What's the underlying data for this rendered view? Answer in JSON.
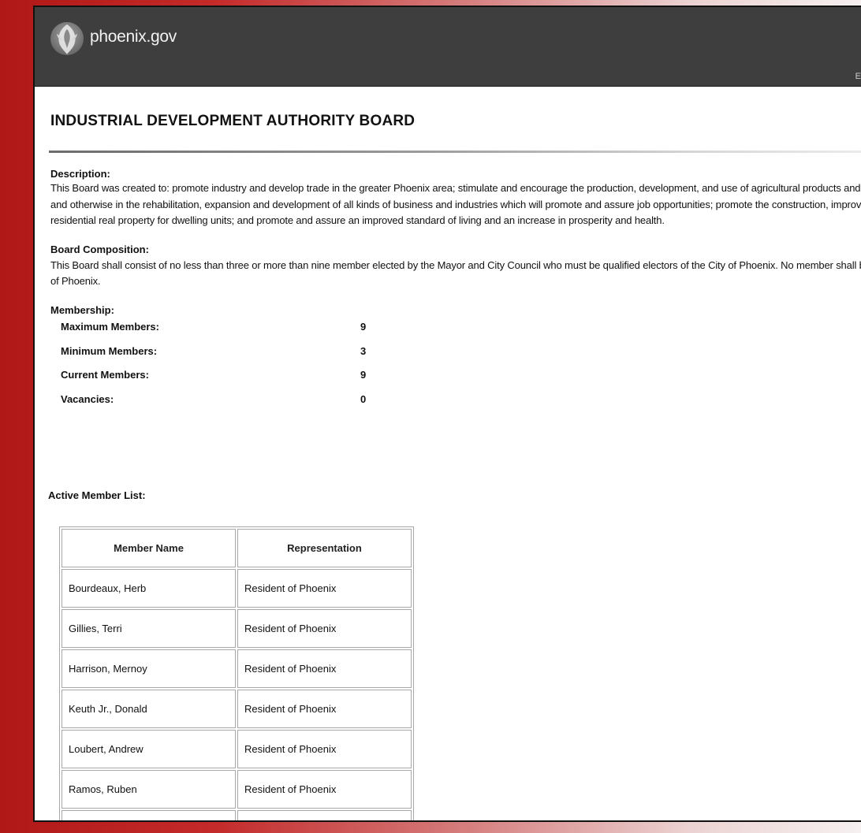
{
  "header": {
    "site_name": "phoenix.gov",
    "edge_text": "E",
    "logo_icon": "phoenix-bird-logo-icon"
  },
  "page": {
    "title": "INDUSTRIAL DEVELOPMENT AUTHORITY BOARD"
  },
  "description": {
    "label": "Description:",
    "lines": [
      "This Board was created to: promote industry and develop trade in the greater Phoenix area; stimulate and encourage the production, development, and use of agricultural products and na",
      "and otherwise in the rehabilitation, expansion and development of all kinds of business and industries which will promote and assure job opportunities; promote the construction, improve",
      "residential real property for dwelling units; and promote and assure an improved standard of living and an increase in prosperity and health."
    ]
  },
  "composition": {
    "label": "Board Composition:",
    "lines": [
      "This Board shall consist of no less than three or more than nine member elected by the Mayor and City Council who must be qualified electors of the City of Phoenix. No member shall be",
      "of Phoenix."
    ]
  },
  "membership": {
    "label": "Membership:",
    "rows": [
      {
        "label": "Maximum Members:",
        "value": "9"
      },
      {
        "label": "Minimum Members:",
        "value": "3"
      },
      {
        "label": "Current Members:",
        "value": "9"
      },
      {
        "label": "Vacancies:",
        "value": "0"
      }
    ]
  },
  "member_list": {
    "label": "Active Member List:",
    "columns": [
      "Member Name",
      "Representation"
    ],
    "rows": [
      [
        "Bourdeaux, Herb",
        "Resident of Phoenix"
      ],
      [
        "Gillies, Terri",
        "Resident of Phoenix"
      ],
      [
        "Harrison, Mernoy",
        "Resident of Phoenix"
      ],
      [
        "Keuth Jr., Donald",
        "Resident of Phoenix"
      ],
      [
        "Loubert, Andrew",
        "Resident of Phoenix"
      ],
      [
        "Ramos, Ruben",
        "Resident of Phoenix"
      ],
      [
        "",
        ""
      ]
    ]
  }
}
